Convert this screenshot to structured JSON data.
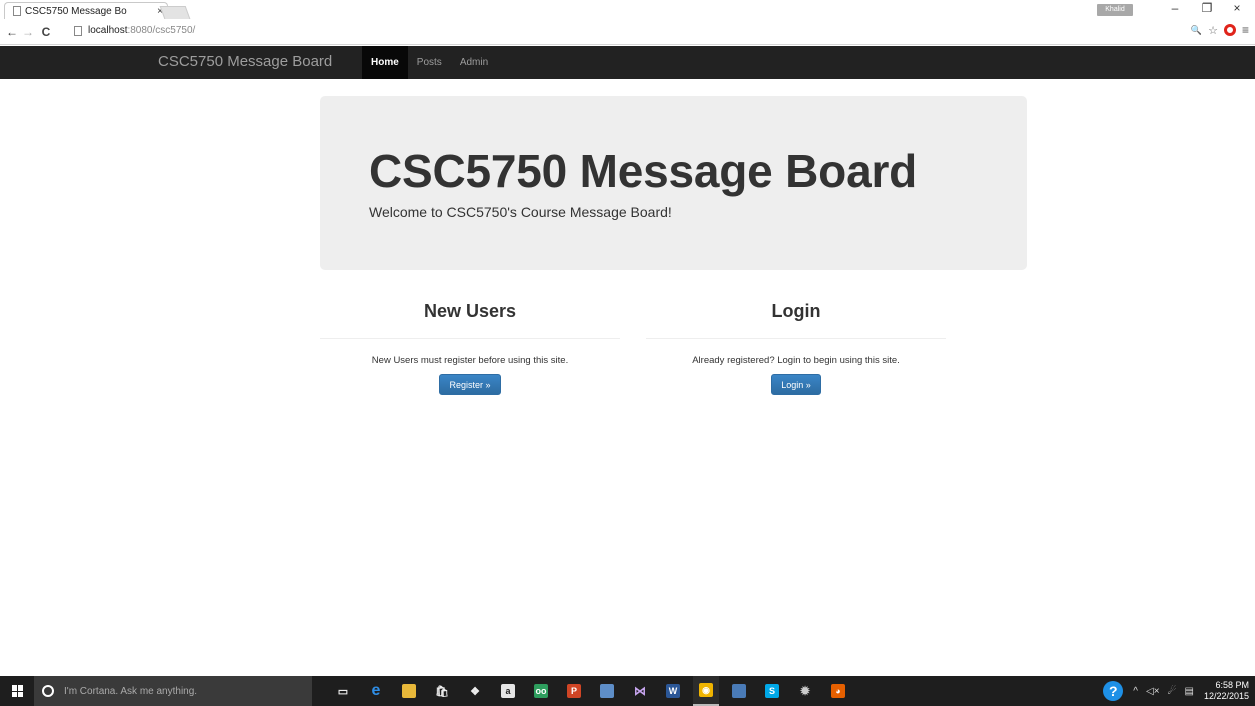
{
  "browser": {
    "tab_title": "CSC5750 Message Bo",
    "tab_close": "×",
    "profile_badge": "Khalid",
    "win_min": "–",
    "win_max": "❐",
    "win_close": "×",
    "back": "←",
    "forward": "→",
    "reload": "C",
    "url_host": "localhost",
    "url_path": ":8080/csc5750/",
    "zoom_glyph": "🔍",
    "star_glyph": "☆",
    "menu_glyph": "≡"
  },
  "navbar": {
    "brand": "CSC5750 Message Board",
    "links": [
      "Home",
      "Posts",
      "Admin"
    ]
  },
  "jumbotron": {
    "title": "CSC5750 Message Board",
    "subtitle": "Welcome to CSC5750's Course Message Board!"
  },
  "new_users": {
    "heading": "New Users",
    "text": "New Users must register before using this site.",
    "button": "Register »"
  },
  "login": {
    "heading": "Login",
    "text": "Already registered? Login to begin using this site.",
    "button": "Login »"
  },
  "taskbar": {
    "search_placeholder": "I'm Cortana. Ask me anything.",
    "icons": [
      {
        "name": "task-view-icon",
        "color": "#1e1e1e",
        "glyph": "▭"
      },
      {
        "name": "edge-icon",
        "color": "#1e1e1e",
        "glyph": "e"
      },
      {
        "name": "file-explorer-icon",
        "color": "#e8b83a",
        "glyph": ""
      },
      {
        "name": "store-icon",
        "color": "#1e1e1e",
        "glyph": "🛍"
      },
      {
        "name": "dropbox-icon",
        "color": "#1e1e1e",
        "glyph": "❖"
      },
      {
        "name": "amazon-icon",
        "color": "#e6e6e6",
        "glyph": "a"
      },
      {
        "name": "tripadvisor-icon",
        "color": "#2e9e5e",
        "glyph": "oo"
      },
      {
        "name": "powerpoint-icon",
        "color": "#d04525",
        "glyph": "P"
      },
      {
        "name": "photos-icon",
        "color": "#5e8ec8",
        "glyph": ""
      },
      {
        "name": "visual-studio-icon",
        "color": "#1e1e1e",
        "glyph": "⋈"
      },
      {
        "name": "word-icon",
        "color": "#2b5797",
        "glyph": "W"
      },
      {
        "name": "chrome-icon",
        "color": "#f0b400",
        "glyph": "◉"
      },
      {
        "name": "ssms-icon",
        "color": "#4a7bb7",
        "glyph": ""
      },
      {
        "name": "skype-icon",
        "color": "#00a8e8",
        "glyph": "S"
      },
      {
        "name": "settings-icon",
        "color": "#1e1e1e",
        "glyph": "✹"
      },
      {
        "name": "firefox-icon",
        "color": "#e66000",
        "glyph": "◕"
      }
    ],
    "tray_glyphs": [
      "^",
      "◁×",
      "☄",
      "▤"
    ],
    "time": "6:58 PM",
    "date": "12/22/2015"
  }
}
